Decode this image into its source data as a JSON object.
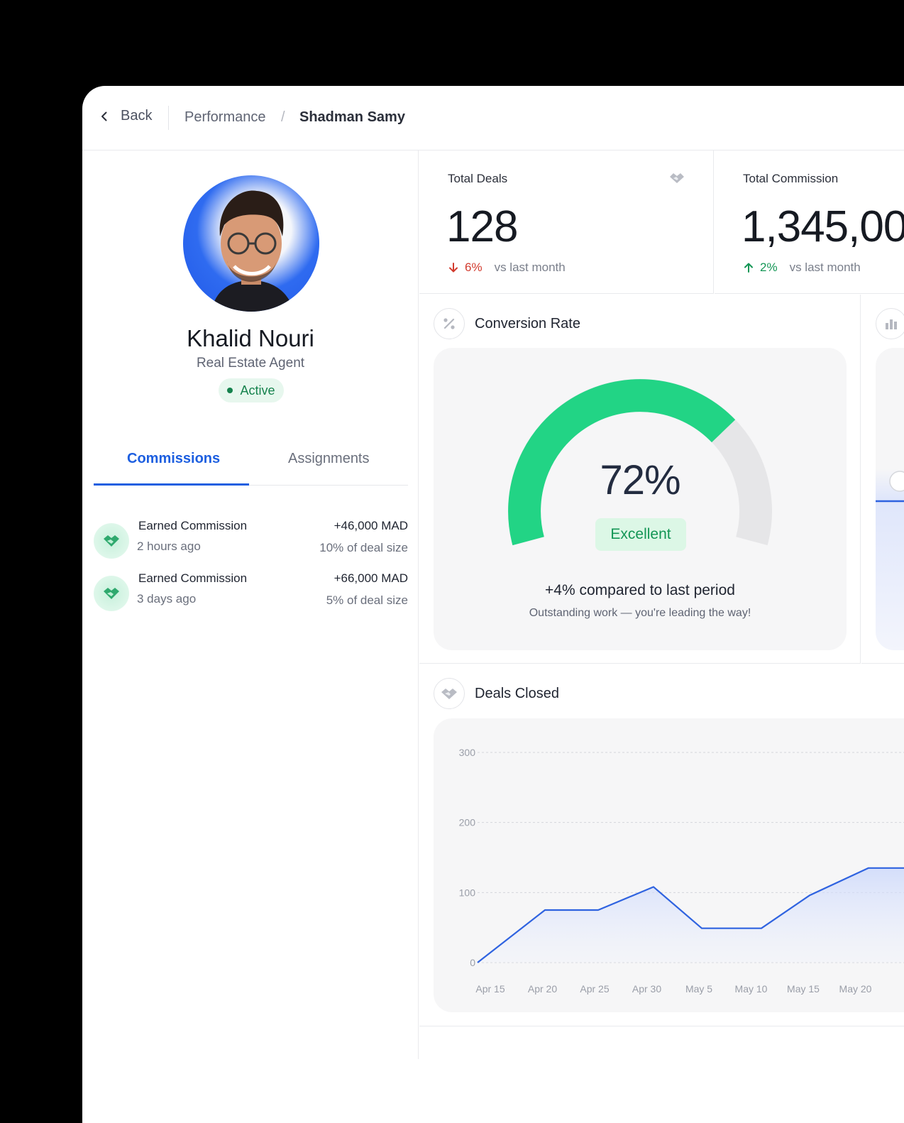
{
  "header": {
    "back_label": "Back",
    "breadcrumb": [
      "Performance",
      "/",
      "Shadman Samy"
    ]
  },
  "profile": {
    "name": "Khalid Nouri",
    "role": "Real Estate Agent",
    "status": "Active"
  },
  "tabs": [
    {
      "label": "Commissions",
      "active": true
    },
    {
      "label": "Assignments",
      "active": false
    }
  ],
  "commissions": [
    {
      "title": "Earned Commission",
      "time": "2 hours ago",
      "amount": "+46,000 MAD",
      "detail": "10% of deal size"
    },
    {
      "title": "Earned Commission",
      "time": "3 days ago",
      "amount": "+66,000 MAD",
      "detail": "5% of deal size"
    }
  ],
  "stats": [
    {
      "label": "Total Deals",
      "value": "128",
      "trend": "6%",
      "direction": "down",
      "vs": "vs last month"
    },
    {
      "label": "Total Commission",
      "value": "1,345,00",
      "trend": "2%",
      "direction": "up",
      "vs": "vs last month"
    }
  ],
  "conversion": {
    "title": "Conversion Rate",
    "value": "72%",
    "percent": 72,
    "badge": "Excellent",
    "comparison": "+4% compared to last period",
    "subtitle": "Outstanding work — you're leading the way!"
  },
  "deals_closed": {
    "title": "Deals Closed"
  },
  "colors": {
    "accent": "#1d5fe0",
    "green": "#22d485",
    "down": "#d23b2e",
    "up": "#139655"
  },
  "chart_data": {
    "type": "area",
    "title": "Deals Closed",
    "x": [
      "Apr 15",
      "Apr 20",
      "Apr 25",
      "Apr 30",
      "May 5",
      "May 10",
      "May 15",
      "May 20"
    ],
    "y_ticks": [
      0,
      100,
      200,
      300
    ],
    "ylim": [
      0,
      300
    ],
    "grid": true,
    "series": [
      {
        "values": [
          0,
          75,
          75,
          108,
          49,
          49,
          96,
          135,
          135
        ]
      }
    ],
    "x_positions_note_free": true
  }
}
